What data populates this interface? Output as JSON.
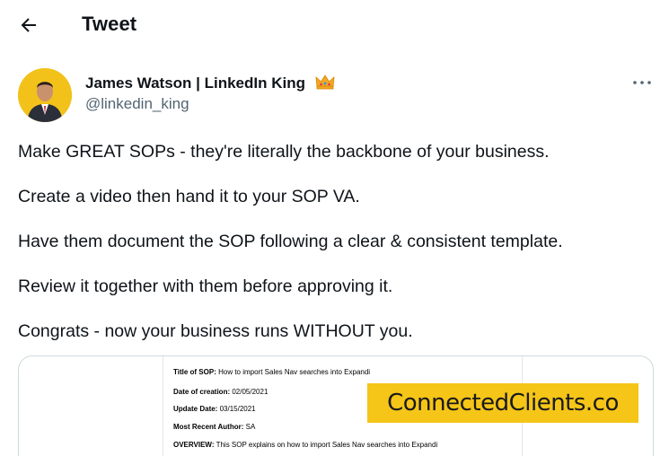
{
  "header": {
    "title": "Tweet",
    "back_icon": "arrow-left-icon"
  },
  "author": {
    "name": "James Watson | LinkedIn King",
    "handle": "@linkedin_king",
    "badge_icon": "crown-emoji-icon",
    "avatar_bg": "#f2c21b"
  },
  "more_icon": "more-horizontal-icon",
  "tweet": {
    "lines": [
      "Make GREAT SOPs - they're literally the backbone of your business.",
      "Create a video then hand it to your SOP VA.",
      "Have them document the SOP following a clear & consistent template.",
      "Review it together with them before approving it.",
      "Congrats - now your business runs WITHOUT you."
    ]
  },
  "media": {
    "doc": {
      "title_label": "Title of SOP:",
      "title_value": "How to import Sales Nav searches into Expandi",
      "created_label": "Date of creation:",
      "created_value": "02/05/2021",
      "updated_label": "Update Date:",
      "updated_value": "03/15/2021",
      "author_label": "Most Recent Author:",
      "author_value": "SA",
      "overview_label": "OVERVIEW:",
      "overview_value": "This SOP explains on how to import Sales Nav searches into Expandi"
    },
    "watermark": "ConnectedClients.co",
    "watermark_bg": "#f5c518"
  },
  "colors": {
    "text": "#0f1419",
    "secondary": "#536471",
    "border": "#cfd9de"
  }
}
